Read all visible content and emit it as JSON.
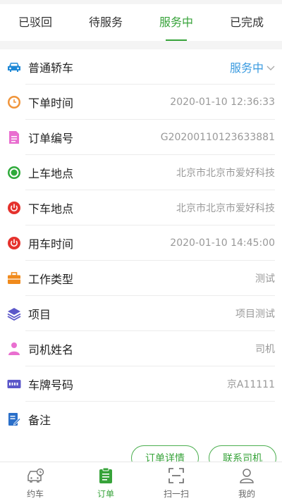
{
  "tabs": [
    {
      "label": "已驳回",
      "active": false
    },
    {
      "label": "待服务",
      "active": false
    },
    {
      "label": "服务中",
      "active": true
    },
    {
      "label": "已完成",
      "active": false
    }
  ],
  "rows": [
    {
      "label": "普通轿车",
      "value": "服务中",
      "icon": "car-icon"
    },
    {
      "label": "下单时间",
      "value": "2020-01-10 12:36:33",
      "icon": "clock-icon"
    },
    {
      "label": "订单编号",
      "value": "G20200110123633881",
      "icon": "document-icon"
    },
    {
      "label": "上车地点",
      "value": "北京市北京市爱好科技",
      "icon": "pickup-dot-icon"
    },
    {
      "label": "下车地点",
      "value": "北京市北京市爱好科技",
      "icon": "power-icon"
    },
    {
      "label": "用车时间",
      "value": "2020-01-10 14:45:00",
      "icon": "power-icon"
    },
    {
      "label": "工作类型",
      "value": "测试",
      "icon": "briefcase-icon"
    },
    {
      "label": "项目",
      "value": "项目测试",
      "icon": "layers-icon"
    },
    {
      "label": "司机姓名",
      "value": "司机",
      "icon": "person-icon"
    },
    {
      "label": "车牌号码",
      "value": "京A11111",
      "icon": "license-plate-icon"
    },
    {
      "label": "备注",
      "value": "",
      "icon": "edit-note-icon"
    }
  ],
  "actions": {
    "detail": "订单详情",
    "contact": "联系司机"
  },
  "nav": [
    {
      "label": "约车",
      "icon": "car-clock-icon",
      "active": false
    },
    {
      "label": "订单",
      "icon": "clipboard-icon",
      "active": true
    },
    {
      "label": "扫一扫",
      "icon": "scan-icon",
      "active": false
    },
    {
      "label": "我的",
      "icon": "user-icon",
      "active": false
    }
  ],
  "colors": {
    "accent": "#37a33a",
    "status": "#3b9be0",
    "muted": "#999999"
  }
}
